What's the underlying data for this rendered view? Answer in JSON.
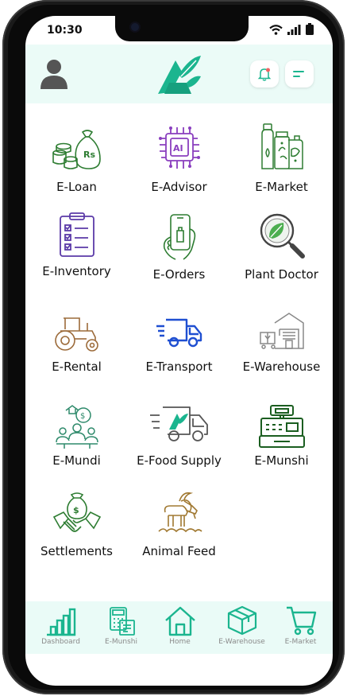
{
  "status": {
    "time": "10:30"
  },
  "header": {
    "avatar": "user-icon",
    "logo": "agri-logo",
    "notification": "bell-icon",
    "menu": "menu-icon"
  },
  "tiles": [
    {
      "label": "E-Loan",
      "icon": "money-bag-icon"
    },
    {
      "label": "E-Advisor",
      "icon": "ai-chip-icon"
    },
    {
      "label": "E-Market",
      "icon": "fertilizer-products-icon"
    },
    {
      "label": "E-Inventory",
      "icon": "clipboard-checklist-icon"
    },
    {
      "label": "E-Orders",
      "icon": "phone-in-hand-icon"
    },
    {
      "label": "Plant Doctor",
      "icon": "leaf-magnifier-icon"
    },
    {
      "label": "E-Rental",
      "icon": "tractor-icon"
    },
    {
      "label": "E-Transport",
      "icon": "delivery-truck-icon"
    },
    {
      "label": "E-Warehouse",
      "icon": "warehouse-icon"
    },
    {
      "label": "E-Mundi",
      "icon": "group-meeting-icon"
    },
    {
      "label": "E-Food Supply",
      "icon": "food-truck-icon"
    },
    {
      "label": "E-Munshi",
      "icon": "cash-register-icon"
    },
    {
      "label": "Settlements",
      "icon": "handshake-icon"
    },
    {
      "label": "Animal Feed",
      "icon": "goat-icon"
    }
  ],
  "bottom_nav": [
    {
      "label": "Dashboard",
      "icon": "bar-chart-icon"
    },
    {
      "label": "E-Munshi",
      "icon": "calculator-doc-icon"
    },
    {
      "label": "Home",
      "icon": "home-icon"
    },
    {
      "label": "E-Warehouse",
      "icon": "box-icon"
    },
    {
      "label": "E-Market",
      "icon": "cart-icon"
    }
  ],
  "colors": {
    "accent": "#1bb58f",
    "header_bg": "#ebfbf7",
    "nav_bg": "#eafbf7",
    "purple": "#8a3fbf",
    "green": "#2e7d32",
    "blue": "#1f4fd1",
    "brown": "#9c6b3a"
  }
}
